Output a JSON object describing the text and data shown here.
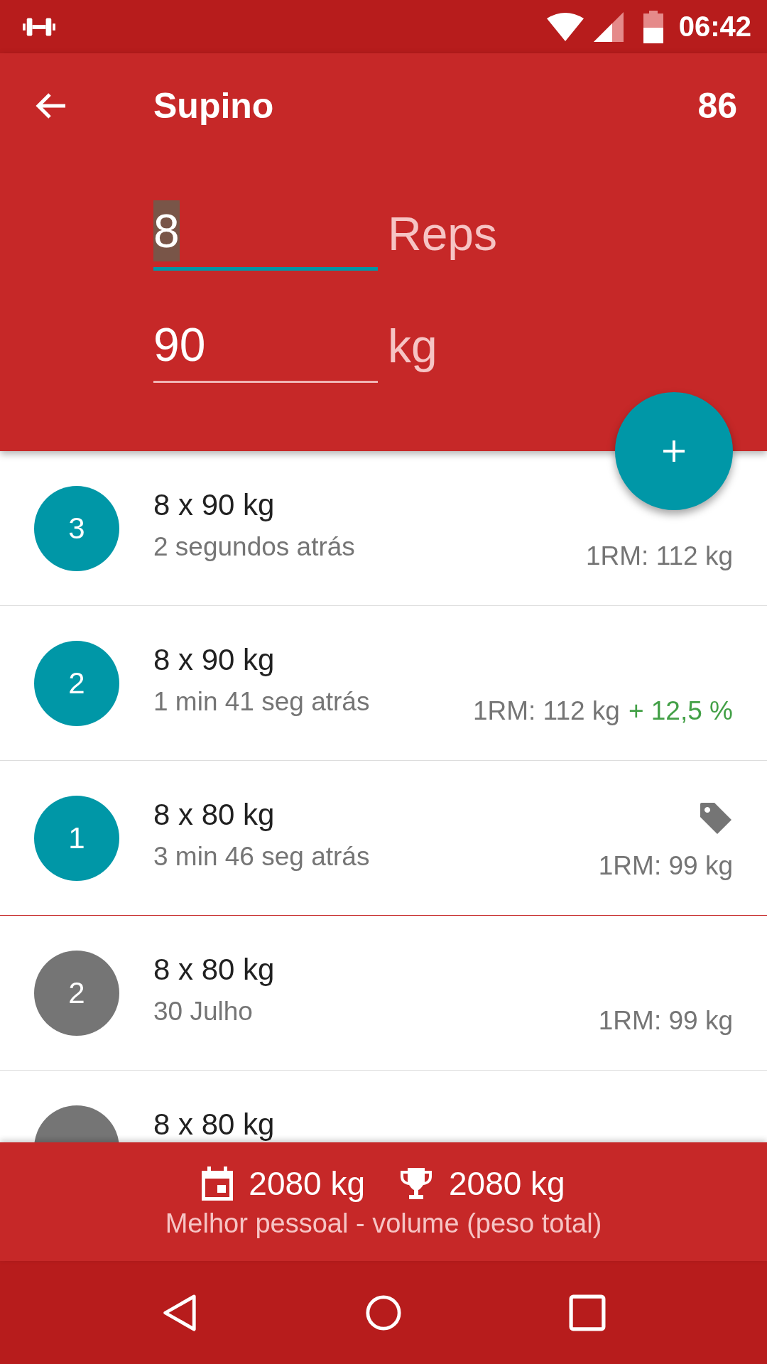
{
  "status_bar": {
    "time": "06:42"
  },
  "toolbar": {
    "title": "Supino",
    "count": "86"
  },
  "inputs": [
    {
      "value": "8",
      "unit": "Reps",
      "focused": true
    },
    {
      "value": "90",
      "unit": "kg",
      "focused": false
    }
  ],
  "sets": [
    {
      "number": "3",
      "title": "8 x 90 kg",
      "time": "2 segundos atrás",
      "one_rm": "1RM: 112 kg",
      "current": true,
      "tagged": false
    },
    {
      "number": "2",
      "title": "8 x 90 kg",
      "time": "1 min 41 seg atrás",
      "one_rm": "1RM: 112 kg",
      "improvement": "+ 12,5 %",
      "current": true,
      "tagged": false
    },
    {
      "number": "1",
      "title": "8 x 80 kg",
      "time": "3 min 46 seg atrás",
      "one_rm": "1RM: 99 kg",
      "current": true,
      "tagged": true
    },
    {
      "number": "2",
      "title": "8 x 80 kg",
      "time": "30 Julho",
      "one_rm": "1RM: 99 kg",
      "current": false,
      "tagged": false
    },
    {
      "title": "8 x 80 kg",
      "current": false,
      "tagged": false
    }
  ],
  "summary": {
    "session_volume": "2080 kg",
    "best_volume": "2080 kg",
    "caption": "Melhor pessoal - volume (peso total)"
  }
}
